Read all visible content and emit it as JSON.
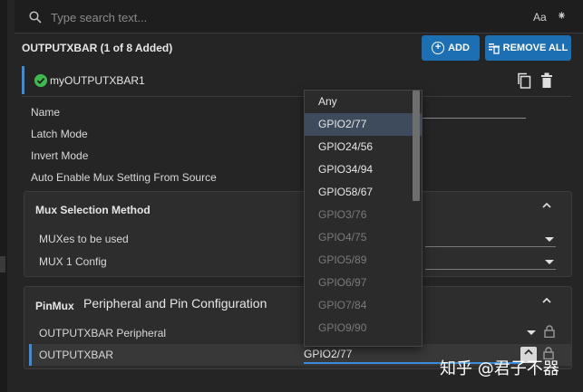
{
  "search": {
    "placeholder": "Type search text...",
    "case_toggle": "Aa",
    "regex_toggle": "⁕"
  },
  "header": {
    "title": "OUTPUTXBAR (1 of 8 Added)",
    "add_label": "ADD",
    "remove_all_label": "REMOVE ALL"
  },
  "instance": {
    "name": "myOUTPUTXBAR1"
  },
  "fields": {
    "name": "Name",
    "latch_mode": "Latch Mode",
    "invert_mode": "Invert Mode",
    "auto_enable": "Auto Enable Mux Setting From Source"
  },
  "mux_group": {
    "title": "Mux Selection Method",
    "muxes_label": "MUXes to be used",
    "mux1_label": "MUX 1 Config"
  },
  "pinmux_group": {
    "title": "PinMux",
    "subtitle": "Peripheral and Pin Configuration",
    "peripheral_label": "OUTPUTXBAR Peripheral",
    "pin_label": "OUTPUTXBAR",
    "pin_value": "GPIO2/77"
  },
  "dropdown": {
    "options": [
      {
        "label": "Any",
        "state": "normal"
      },
      {
        "label": "GPIO2/77",
        "state": "selected"
      },
      {
        "label": "GPIO24/56",
        "state": "normal"
      },
      {
        "label": "GPIO34/94",
        "state": "normal"
      },
      {
        "label": "GPIO58/67",
        "state": "normal"
      },
      {
        "label": "GPIO3/76",
        "state": "disabled"
      },
      {
        "label": "GPIO4/75",
        "state": "disabled"
      },
      {
        "label": "GPIO5/89",
        "state": "disabled"
      },
      {
        "label": "GPIO6/97",
        "state": "disabled"
      },
      {
        "label": "GPIO7/84",
        "state": "disabled"
      },
      {
        "label": "GPIO9/90",
        "state": "disabled"
      }
    ]
  },
  "watermark": "知乎 @君子不器",
  "colors": {
    "accent": "#1d6fb3",
    "accent_line": "#3c8cdc",
    "success": "#3fb950"
  }
}
